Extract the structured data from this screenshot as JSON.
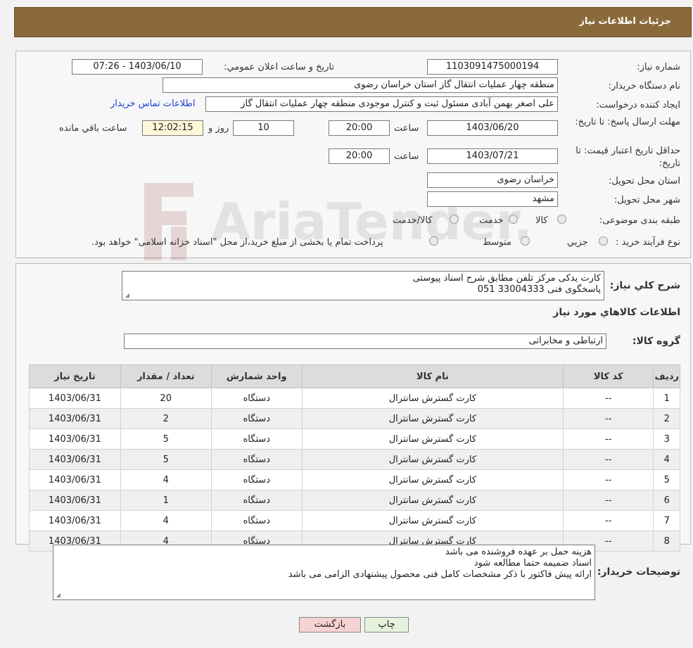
{
  "header": {
    "title": "جزئیات اطلاعات نیاز"
  },
  "form": {
    "need_number_label": "شماره نیاز:",
    "need_number": "1103091475000194",
    "announce_label": "تاریخ و ساعت اعلان عمومي:",
    "announce_value": "1403/06/10 - 07:26",
    "buyer_org_label": "نام دستگاه خریدار:",
    "buyer_org": "منطقه چهار عملیات انتقال گاز   استان خراسان رضوی",
    "creator_label": "ایجاد کننده درخواست:",
    "creator": "علی اصغر بهمن آبادی مسئول ثبت و کنترل موجودی منطقه چهار عملیات انتقال گاز",
    "contact_link": "اطلاعات تماس خریدار",
    "deadline_label": "مهلت ارسال پاسخ: تا تاریخ:",
    "deadline_date": "1403/06/20",
    "time_label": "ساعت",
    "deadline_time": "20:00",
    "days_value": "10",
    "days_label": "روز و",
    "remaining_time": "12:02:15",
    "remaining_label": "ساعت باقي مانده",
    "validity_label": "حداقل تاریخ اعتبار قیمت: تا تاریخ:",
    "validity_date": "1403/07/21",
    "validity_time": "20:00",
    "province_label": "استان محل تحویل:",
    "province": "خراسان رضوی",
    "city_label": "شهر محل تحویل:",
    "city": "مشهد",
    "category_label": "طبقه بندی موضوعی:",
    "category_options": [
      "کالا",
      "خدمت",
      "کالا/خدمت"
    ],
    "process_label": "نوع فرآیند خرید :",
    "process_options": [
      "جزيي",
      "متوسط"
    ],
    "payment_note": "پرداخت تمام یا بخشی از مبلغ خرید،از محل \"اسناد خزانه اسلامی\" خواهد بود."
  },
  "summary": {
    "label": "شرح کلي نياز:",
    "text_line1": "کارت یدکی مرکز تلفن مطابق شرح اسناد پیوستی",
    "text_line2": "پاسخگوی فنی  33004333 051",
    "items_heading": "اطلاعات کالاهاي مورد نياز",
    "group_label": "گروه کالا:",
    "group_value": "ارتباطی و مخابراتی"
  },
  "table": {
    "headers": [
      "رديف",
      "کد کالا",
      "نام کالا",
      "واحد شمارش",
      "تعداد / مقدار",
      "تاريخ نياز"
    ],
    "rows": [
      [
        "1",
        "--",
        "کارت گسترش سانترال",
        "دستگاه",
        "20",
        "1403/06/31"
      ],
      [
        "2",
        "--",
        "کارت گسترش سانترال",
        "دستگاه",
        "2",
        "1403/06/31"
      ],
      [
        "3",
        "--",
        "کارت گسترش سانترال",
        "دستگاه",
        "5",
        "1403/06/31"
      ],
      [
        "4",
        "--",
        "کارت گسترش سانترال",
        "دستگاه",
        "5",
        "1403/06/31"
      ],
      [
        "5",
        "--",
        "کارت گسترش سانترال",
        "دستگاه",
        "4",
        "1403/06/31"
      ],
      [
        "6",
        "--",
        "کارت گسترش سانترال",
        "دستگاه",
        "1",
        "1403/06/31"
      ],
      [
        "7",
        "--",
        "کارت گسترش سانترال",
        "دستگاه",
        "4",
        "1403/06/31"
      ],
      [
        "8",
        "--",
        "کارت گسترش سانترال",
        "دستگاه",
        "4",
        "1403/06/31"
      ]
    ]
  },
  "buyer_notes": {
    "label": "توضیحات خریدار:",
    "lines": [
      "هزینه حمل بر عهده فروشنده می باشد",
      "اسناد ضمیمه حتما مطالعه شود",
      "ارائه پیش فاکتور با ذکر مشخصات کامل فنی محصول پیشنهادی الزامی می باشد"
    ]
  },
  "buttons": {
    "print": "چاپ",
    "back": "بازگشت"
  },
  "watermark": {
    "text": "AriaTender.neT"
  },
  "colors": {
    "header": "#8a6a3a",
    "back_button": "#f6d2d2",
    "print_button": "#e6f2dc",
    "remaining_box": "#fff8d8",
    "link": "#1a3fd6"
  }
}
